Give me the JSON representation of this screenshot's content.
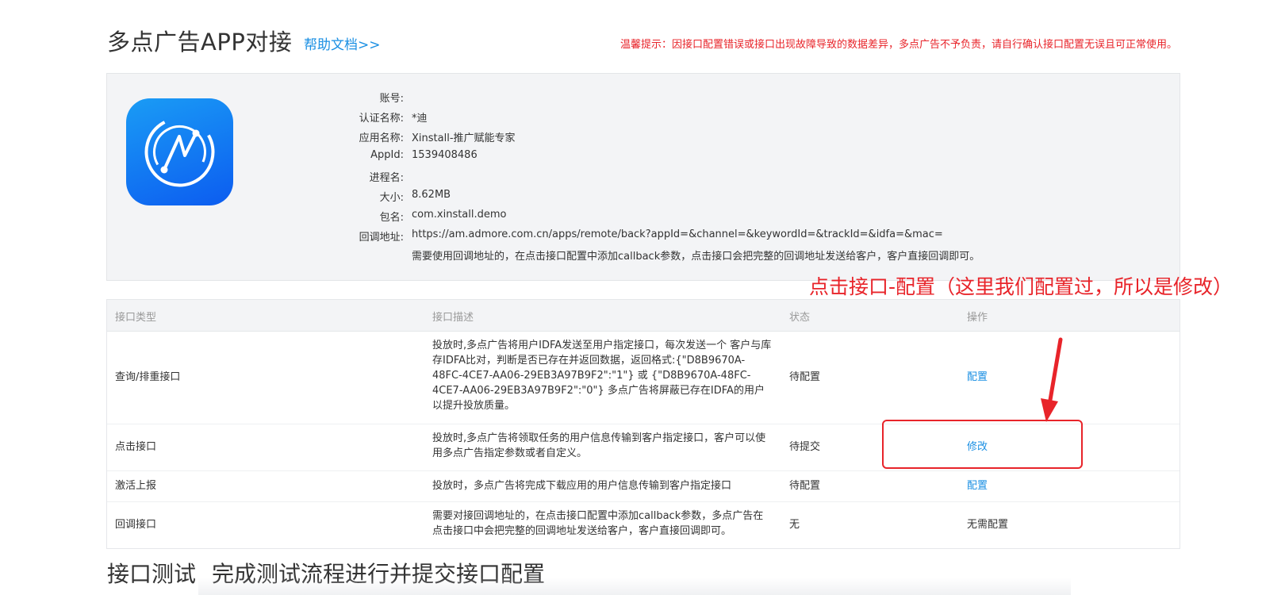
{
  "header": {
    "title": "多点广告APP对接",
    "help_link": "帮助文档>>",
    "warning": "温馨提示：因接口配置错误或接口出现故障导致的数据差异，多点广告不予负责，请自行确认接口配置无误且可正常使用。"
  },
  "app_info": {
    "icon": "xinstall-app-logo",
    "brand_color": "#0f6cf2",
    "rows": [
      {
        "label": "账号:",
        "value": ""
      },
      {
        "label": "认证名称:",
        "value": "*迪"
      },
      {
        "label": "应用名称:",
        "value": "Xinstall-推广赋能专家"
      },
      {
        "label": "AppId:",
        "value": "1539408486"
      },
      {
        "label": "进程名:",
        "value": ""
      },
      {
        "label": "大小:",
        "value": "8.62MB"
      },
      {
        "label": "包名:",
        "value": "com.xinstall.demo"
      },
      {
        "label": "回调地址:",
        "value": "https://am.admore.com.cn/apps/remote/back?appId=&channel=&keywordId=&trackId=&idfa=&mac="
      }
    ],
    "callback_note": "需要使用回调地址的，在点击接口配置中添加callback参数，点击接口会把完整的回调地址发送给客户，客户直接回调即可。"
  },
  "annotation": {
    "text": "点击接口-配置（这里我们配置过，所以是修改）",
    "color": "#e8242a"
  },
  "table": {
    "headers": [
      "接口类型",
      "接口描述",
      "状态",
      "操作"
    ],
    "rows": [
      {
        "type": "查询/排重接口",
        "desc": "投放时,多点广告将用户IDFA发送至用户指定接口，每次发送一个 客户与库存IDFA比对，判断是否已存在并返回数据，返回格式:{\"D8B9670A-48FC-4CE7-AA06-29EB3A97B9F2\":\"1\"} 或 {\"D8B9670A-48FC-4CE7-AA06-29EB3A97B9F2\":\"0\"} 多点广告将屏蔽已存在IDFA的用户以提升投放质量。",
        "status": "待配置",
        "action": "配置",
        "action_is_link": true
      },
      {
        "type": "点击接口",
        "desc": "投放时,多点广告将领取任务的用户信息传输到客户指定接口，客户可以使用多点广告指定参数或者自定义。",
        "status": "待提交",
        "action": "修改",
        "action_is_link": true
      },
      {
        "type": "激活上报",
        "desc": "投放时，多点广告将完成下载应用的用户信息传输到客户指定接口",
        "status": "待配置",
        "action": "配置",
        "action_is_link": true
      },
      {
        "type": "回调接口",
        "desc": "需要对接回调地址的，在点击接口配置中添加callback参数，多点广告在点击接口中会把完整的回调地址发送给客户，客户直接回调即可。",
        "status": "无",
        "action": "无需配置",
        "action_is_link": false
      }
    ]
  },
  "section": {
    "title": "接口测试",
    "subtitle": "完成测试流程进行并提交接口配置"
  },
  "colors": {
    "link": "#1a8fe3",
    "warning": "#e8242a",
    "panel_bg": "#f3f4f6"
  }
}
